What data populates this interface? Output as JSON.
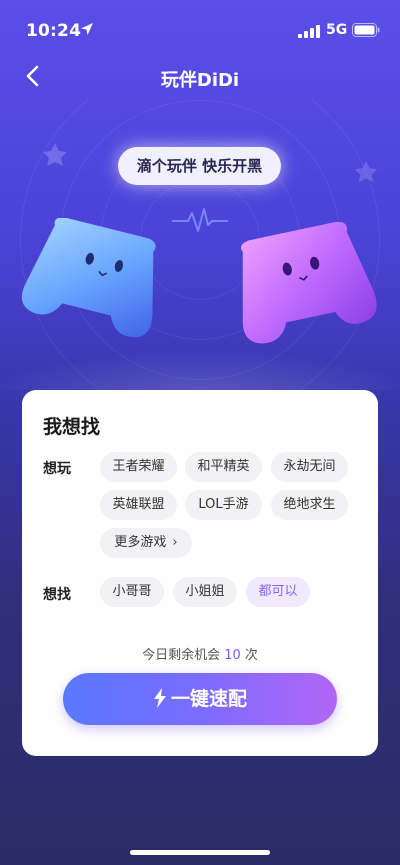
{
  "status_bar": {
    "time": "10:24",
    "network": "5G",
    "icons": [
      "location-arrow-icon",
      "signal-icon",
      "battery-icon"
    ]
  },
  "nav": {
    "title": "玩伴DiDi",
    "back_icon": "back-chevron-icon"
  },
  "hero": {
    "bubble_text": "滴个玩伴 快乐开黑",
    "icons": [
      "pulse-icon",
      "gamepad-blue",
      "gamepad-purple",
      "star-icon"
    ]
  },
  "card": {
    "title": "我想找",
    "play": {
      "label": "想玩",
      "chips": [
        "王者荣耀",
        "和平精英",
        "永劫无间",
        "英雄联盟",
        "LOL手游",
        "绝地求生"
      ],
      "more": "更多游戏"
    },
    "find": {
      "label": "想找",
      "chips": [
        "小哥哥",
        "小姐姐",
        "都可以"
      ],
      "selected": "都可以"
    },
    "chance": {
      "prefix": "今日剩余机会",
      "count": "10",
      "suffix": "次"
    },
    "match_button": "一键速配"
  },
  "colors": {
    "accent": "#7b5cff",
    "bg_top": "#5a4ee8",
    "bg_bottom": "#2b2c66"
  }
}
